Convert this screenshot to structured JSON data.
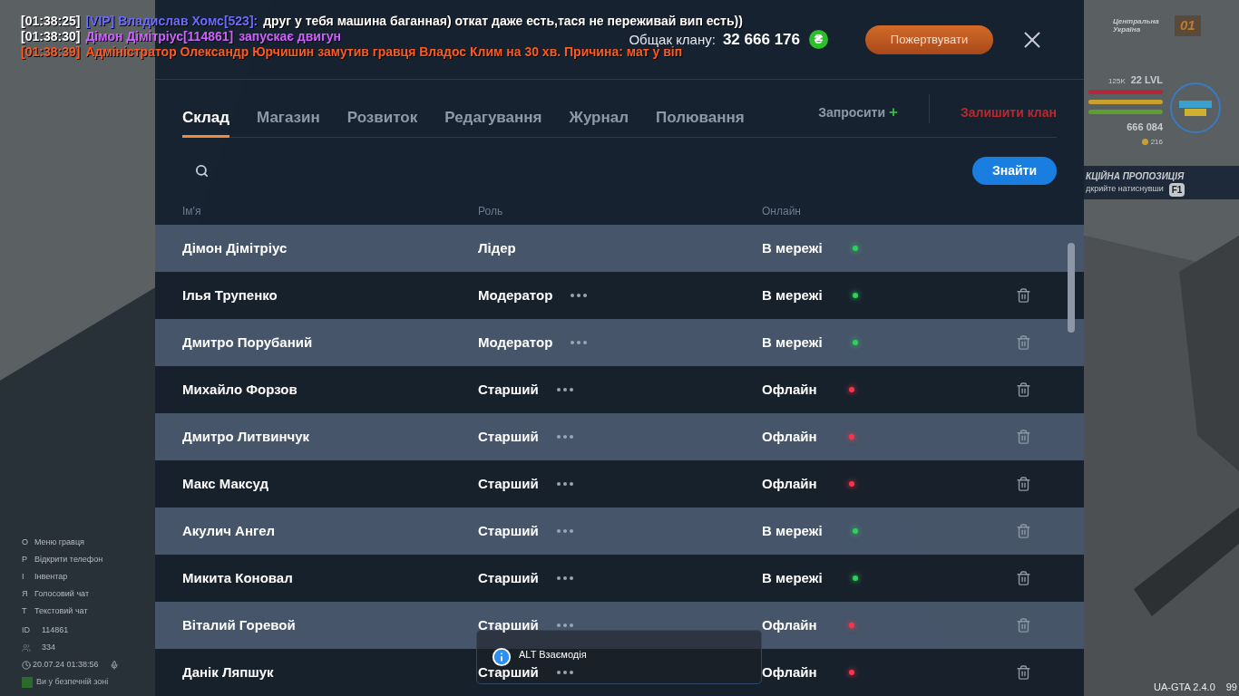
{
  "chat": [
    {
      "time": "[01:38:25]",
      "kind": "vip",
      "author": "[VIP] Владислав Хомс[523]:",
      "text": "друг у тебя машина баганная) откат даже есть,тася не переживай вип есть))"
    },
    {
      "time": "[01:38:30]",
      "kind": "action",
      "author": "Дімон Дімітріус[114861]",
      "text": "запускає двигун"
    },
    {
      "time": "[01:38:39]",
      "kind": "admin",
      "text": "Адміністратор Олександр Юрчишин замутив гравця Владос Клим на 30 хв. Причина: мат у віп"
    }
  ],
  "header": {
    "treasury_label": "Общак клану:",
    "treasury_value": "32 666 176",
    "coin": "₴",
    "donate_button": "Пожертвувати"
  },
  "tabs": [
    {
      "label": "Склад",
      "selected": true
    },
    {
      "label": "Магазин",
      "selected": false
    },
    {
      "label": "Розвиток",
      "selected": false
    },
    {
      "label": "Редагування",
      "selected": false
    },
    {
      "label": "Журнал",
      "selected": false
    },
    {
      "label": "Полювання",
      "selected": false
    }
  ],
  "invite_button": "Запросити",
  "invite_plus": "+",
  "leave_button": "Залишити клан",
  "search": {
    "button": "Знайти"
  },
  "table": {
    "columns": [
      "Ім'я",
      "Роль",
      "Онлайн"
    ],
    "rows": [
      {
        "name": "Дімон Дімітріус",
        "role": "Лідер",
        "kind": "leader",
        "status": "В мережі",
        "online": true
      },
      {
        "name": "Ілья Трупенко",
        "role": "Модератор",
        "kind": "member",
        "status": "В мережі",
        "online": true
      },
      {
        "name": "Дмитро Порубаний",
        "role": "Модератор",
        "kind": "member",
        "status": "В мережі",
        "online": true
      },
      {
        "name": "Михайло Форзов",
        "role": "Старший",
        "kind": "member",
        "status": "Офлайн",
        "online": false
      },
      {
        "name": "Дмитро Литвинчук",
        "role": "Старший",
        "kind": "member",
        "status": "Офлайн",
        "online": false
      },
      {
        "name": "Макс Максуд",
        "role": "Старший",
        "kind": "member",
        "status": "Офлайн",
        "online": false
      },
      {
        "name": "Акулич Ангел",
        "role": "Старший",
        "kind": "member",
        "status": "В мережі",
        "online": true
      },
      {
        "name": "Микита Коновал",
        "role": "Старший",
        "kind": "member",
        "status": "В мережі",
        "online": true
      },
      {
        "name": "Віталий Горевой",
        "role": "Старший",
        "kind": "member",
        "status": "Офлайн",
        "online": false
      },
      {
        "name": "Данік Ляпшук",
        "role": "Старший",
        "kind": "member",
        "status": "Офлайн",
        "online": false
      }
    ]
  },
  "hint": {
    "text": "ALT Взаємодія"
  },
  "hud_left": {
    "keys": [
      {
        "key": "O",
        "label": "Меню гравця"
      },
      {
        "key": "P",
        "label": "Відкрити телефон"
      },
      {
        "key": "I",
        "label": "Інвентар"
      },
      {
        "key": "Я",
        "label": "Голосовий чат"
      },
      {
        "key": "T",
        "label": "Текстовий чат"
      }
    ],
    "id_label": "ID",
    "id": "114861",
    "players": "334",
    "datetime": "20.07.24 01:38:56",
    "zone": "Ви у безпечній зоні"
  },
  "hud_right": {
    "region": "Центральна Україна",
    "region_number": "01",
    "xp": "125K",
    "level": "22 LVL",
    "money": "666 084",
    "coins": "216",
    "promo_title": "КЦІЙНА ПРОПОЗИЦІЯ",
    "promo_text": "дкрийте натиснувши",
    "promo_key": "F1"
  },
  "footer": {
    "version": "UA-GTA 2.4.0",
    "fps": "99"
  }
}
